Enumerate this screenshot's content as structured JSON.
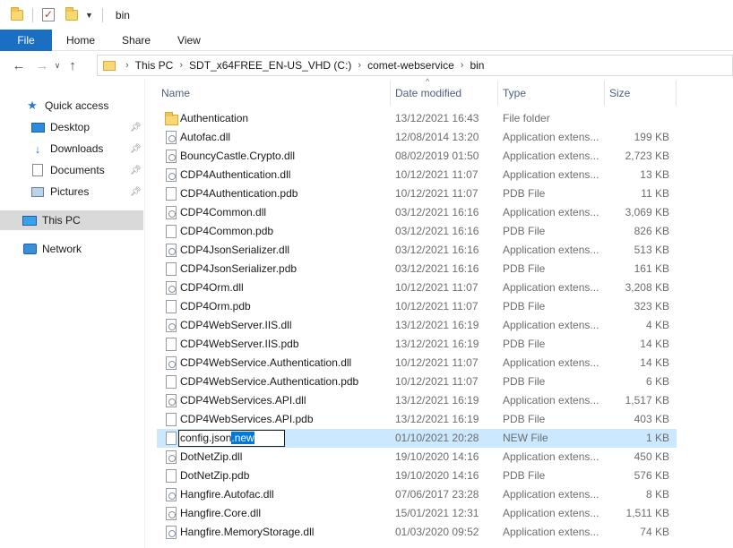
{
  "window": {
    "title": "bin"
  },
  "ribbon": {
    "tabs": [
      "File",
      "Home",
      "Share",
      "View"
    ]
  },
  "address": {
    "crumbs": [
      "This PC",
      "SDT_x64FREE_EN-US_VHD (C:)",
      "comet-webservice",
      "bin"
    ]
  },
  "sidebar": {
    "items": [
      {
        "label": "Quick access",
        "icon": "star-icon"
      },
      {
        "label": "Desktop",
        "icon": "desktop-icon",
        "pinned": true
      },
      {
        "label": "Downloads",
        "icon": "download-icon",
        "pinned": true
      },
      {
        "label": "Documents",
        "icon": "documents-icon",
        "pinned": true
      },
      {
        "label": "Pictures",
        "icon": "pictures-icon",
        "pinned": true
      },
      {
        "label": "This PC",
        "icon": "computer-icon",
        "selected": true
      },
      {
        "label": "Network",
        "icon": "network-icon"
      }
    ]
  },
  "columns": {
    "name": "Name",
    "date": "Date modified",
    "type": "Type",
    "size": "Size"
  },
  "rename": {
    "base": "config.json",
    "selected_ext": ".new"
  },
  "files": [
    {
      "name": "Authentication",
      "date": "13/12/2021 16:43",
      "type": "File folder",
      "size": "",
      "kind": "folder"
    },
    {
      "name": "Autofac.dll",
      "date": "12/08/2014 13:20",
      "type": "Application extens...",
      "size": "199 KB",
      "kind": "dll"
    },
    {
      "name": "BouncyCastle.Crypto.dll",
      "date": "08/02/2019 01:50",
      "type": "Application extens...",
      "size": "2,723 KB",
      "kind": "dll"
    },
    {
      "name": "CDP4Authentication.dll",
      "date": "10/12/2021 11:07",
      "type": "Application extens...",
      "size": "13 KB",
      "kind": "dll"
    },
    {
      "name": "CDP4Authentication.pdb",
      "date": "10/12/2021 11:07",
      "type": "PDB File",
      "size": "11 KB",
      "kind": "page"
    },
    {
      "name": "CDP4Common.dll",
      "date": "03/12/2021 16:16",
      "type": "Application extens...",
      "size": "3,069 KB",
      "kind": "dll"
    },
    {
      "name": "CDP4Common.pdb",
      "date": "03/12/2021 16:16",
      "type": "PDB File",
      "size": "826 KB",
      "kind": "page"
    },
    {
      "name": "CDP4JsonSerializer.dll",
      "date": "03/12/2021 16:16",
      "type": "Application extens...",
      "size": "513 KB",
      "kind": "dll"
    },
    {
      "name": "CDP4JsonSerializer.pdb",
      "date": "03/12/2021 16:16",
      "type": "PDB File",
      "size": "161 KB",
      "kind": "page"
    },
    {
      "name": "CDP4Orm.dll",
      "date": "10/12/2021 11:07",
      "type": "Application extens...",
      "size": "3,208 KB",
      "kind": "dll"
    },
    {
      "name": "CDP4Orm.pdb",
      "date": "10/12/2021 11:07",
      "type": "PDB File",
      "size": "323 KB",
      "kind": "page"
    },
    {
      "name": "CDP4WebServer.IIS.dll",
      "date": "13/12/2021 16:19",
      "type": "Application extens...",
      "size": "4 KB",
      "kind": "dll"
    },
    {
      "name": "CDP4WebServer.IIS.pdb",
      "date": "13/12/2021 16:19",
      "type": "PDB File",
      "size": "14 KB",
      "kind": "page"
    },
    {
      "name": "CDP4WebService.Authentication.dll",
      "date": "10/12/2021 11:07",
      "type": "Application extens...",
      "size": "14 KB",
      "kind": "dll"
    },
    {
      "name": "CDP4WebService.Authentication.pdb",
      "date": "10/12/2021 11:07",
      "type": "PDB File",
      "size": "6 KB",
      "kind": "page"
    },
    {
      "name": "CDP4WebServices.API.dll",
      "date": "13/12/2021 16:19",
      "type": "Application extens...",
      "size": "1,517 KB",
      "kind": "dll"
    },
    {
      "name": "CDP4WebServices.API.pdb",
      "date": "13/12/2021 16:19",
      "type": "PDB File",
      "size": "403 KB",
      "kind": "page"
    },
    {
      "name": "",
      "date": "01/10/2021 20:28",
      "type": "NEW File",
      "size": "1 KB",
      "kind": "page",
      "renaming": true
    },
    {
      "name": "DotNetZip.dll",
      "date": "19/10/2020 14:16",
      "type": "Application extens...",
      "size": "450 KB",
      "kind": "dll"
    },
    {
      "name": "DotNetZip.pdb",
      "date": "19/10/2020 14:16",
      "type": "PDB File",
      "size": "576 KB",
      "kind": "page"
    },
    {
      "name": "Hangfire.Autofac.dll",
      "date": "07/06/2017 23:28",
      "type": "Application extens...",
      "size": "8 KB",
      "kind": "dll"
    },
    {
      "name": "Hangfire.Core.dll",
      "date": "15/01/2021 12:31",
      "type": "Application extens...",
      "size": "1,511 KB",
      "kind": "dll"
    },
    {
      "name": "Hangfire.MemoryStorage.dll",
      "date": "01/03/2020 09:52",
      "type": "Application extens...",
      "size": "74 KB",
      "kind": "dll"
    }
  ]
}
